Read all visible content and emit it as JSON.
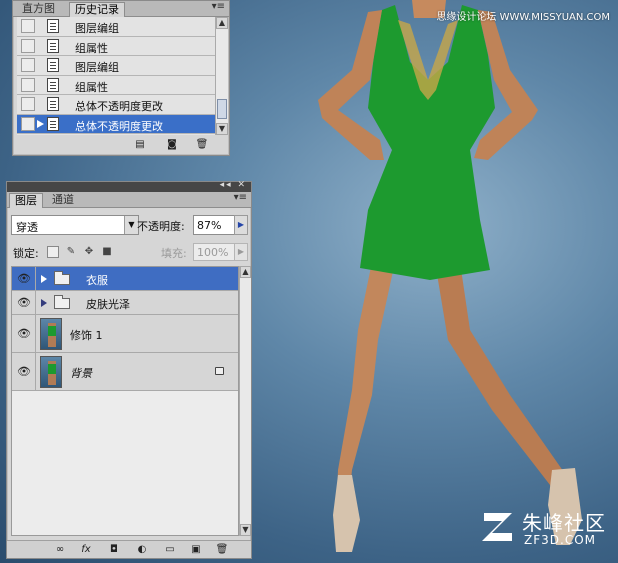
{
  "watermark_top": "思缘设计论坛 WWW.MISSYUAN.COM",
  "logo": {
    "name": "朱峰社区",
    "url": "ZF3D.COM"
  },
  "history_panel": {
    "tabs": [
      "直方图",
      "历史记录"
    ],
    "active_tab": 1,
    "items": [
      {
        "label": "图层编组",
        "selected": false
      },
      {
        "label": "组属性",
        "selected": false
      },
      {
        "label": "图层编组",
        "selected": false
      },
      {
        "label": "组属性",
        "selected": false
      },
      {
        "label": "总体不透明度更改",
        "selected": false
      },
      {
        "label": "总体不透明度更改",
        "selected": true
      }
    ],
    "footer_icons": [
      "new-document-from-state-icon",
      "camera-snapshot-icon",
      "trash-icon"
    ]
  },
  "layers_panel": {
    "tabs": [
      "图层",
      "通道"
    ],
    "active_tab": 0,
    "blend_mode": "穿透",
    "opacity_label": "不透明度:",
    "opacity_value": "87%",
    "lock_label": "锁定:",
    "fill_label": "填充:",
    "fill_value": "100%",
    "layers": [
      {
        "name": "衣服",
        "type": "group",
        "visible": true,
        "selected": true
      },
      {
        "name": "皮肤光泽",
        "type": "group",
        "visible": true,
        "selected": false
      },
      {
        "name": "修饰 1",
        "type": "layer",
        "visible": true,
        "selected": false
      },
      {
        "name": "背景",
        "type": "background",
        "visible": true,
        "selected": false,
        "locked": true
      }
    ],
    "bottom_icons": [
      "link-icon",
      "fx-icon",
      "mask-icon",
      "adjustment-icon",
      "group-folder-icon",
      "new-layer-icon",
      "trash-icon"
    ]
  },
  "colors": {
    "selection": "#3f6dc2",
    "panel_bg": "#d6d6d6",
    "dress": "#1d9a2f",
    "backdrop": "#4a7396"
  }
}
